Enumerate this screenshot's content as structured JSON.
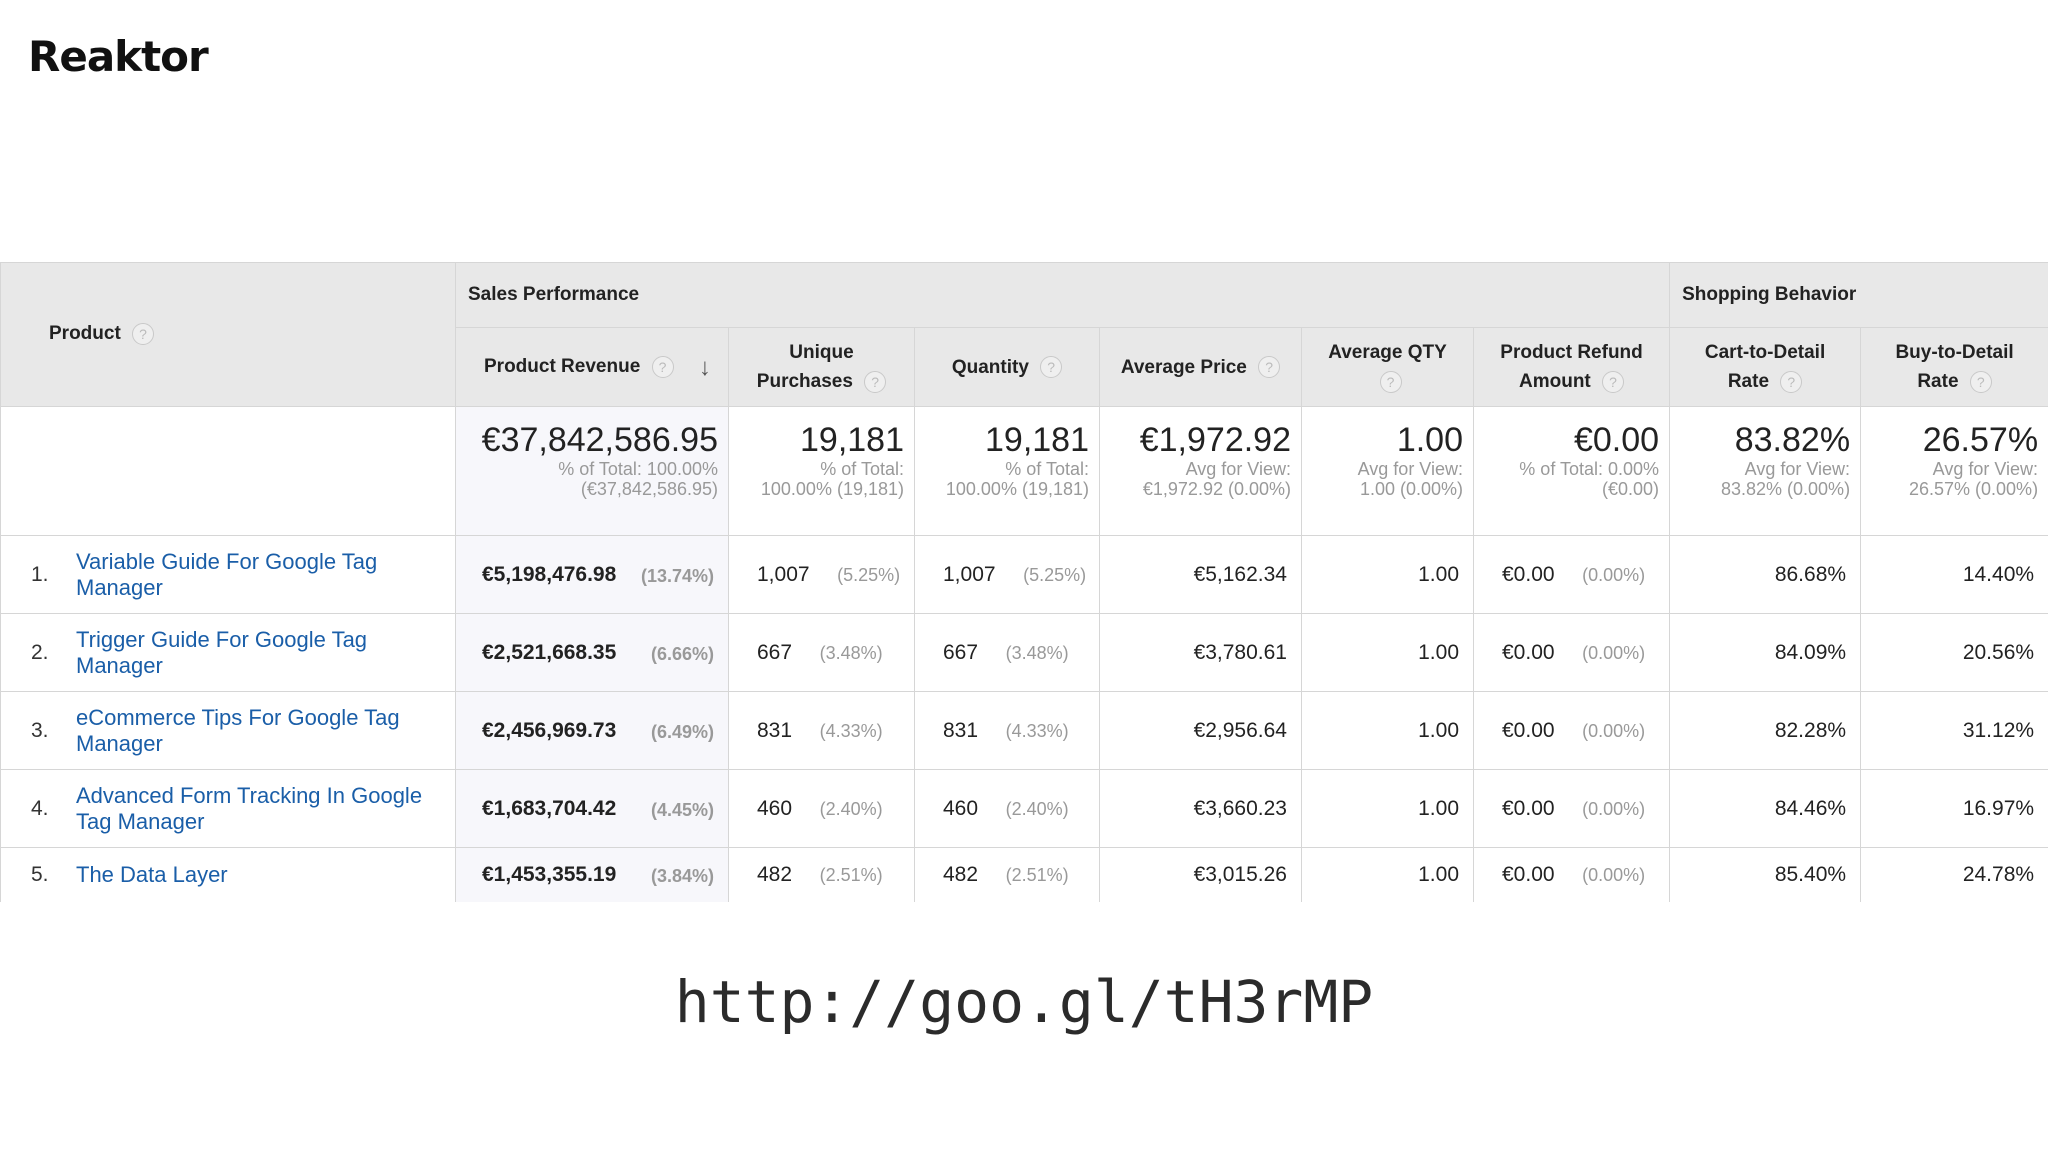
{
  "logo": "Reaktor",
  "groups": {
    "sales": "Sales Performance",
    "shopping": "Shopping Behavior"
  },
  "headers": {
    "product": "Product",
    "revenue": "Product Revenue",
    "unique_l1": "Unique",
    "unique_l2": "Purchases",
    "quantity": "Quantity",
    "avg_price": "Average Price",
    "avg_qty_l1": "Average QTY",
    "refund_l1": "Product Refund",
    "refund_l2": "Amount",
    "c2d_l1": "Cart-to-Detail",
    "c2d_l2": "Rate",
    "b2d_l1": "Buy-to-Detail",
    "b2d_l2": "Rate"
  },
  "totals": {
    "revenue": {
      "value": "€37,842,586.95",
      "s1": "% of Total: 100.00%",
      "s2": "(€37,842,586.95)"
    },
    "unique": {
      "value": "19,181",
      "s1": "% of Total:",
      "s2": "100.00% (19,181)"
    },
    "quantity": {
      "value": "19,181",
      "s1": "% of Total:",
      "s2": "100.00% (19,181)"
    },
    "avg_price": {
      "value": "€1,972.92",
      "s1": "Avg for View:",
      "s2": "€1,972.92 (0.00%)"
    },
    "avg_qty": {
      "value": "1.00",
      "s1": "Avg for View:",
      "s2": "1.00 (0.00%)"
    },
    "refund": {
      "value": "€0.00",
      "s1": "% of Total: 0.00%",
      "s2": "(€0.00)"
    },
    "c2d": {
      "value": "83.82%",
      "s1": "Avg for View:",
      "s2": "83.82% (0.00%)"
    },
    "b2d": {
      "value": "26.57%",
      "s1": "Avg for View:",
      "s2": "26.57% (0.00%)"
    }
  },
  "rows": [
    {
      "rank": "1.",
      "product": "Variable Guide For Google Tag Manager",
      "revenue": "€5,198,476.98",
      "revenue_pct": "(13.74%)",
      "unique": "1,007",
      "unique_pct": "(5.25%)",
      "quantity": "1,007",
      "quantity_pct": "(5.25%)",
      "avg_price": "€5,162.34",
      "avg_qty": "1.00",
      "refund": "€0.00",
      "refund_pct": "(0.00%)",
      "c2d": "86.68%",
      "b2d": "14.40%"
    },
    {
      "rank": "2.",
      "product": "Trigger Guide For Google Tag Manager",
      "revenue": "€2,521,668.35",
      "revenue_pct": "(6.66%)",
      "unique": "667",
      "unique_pct": "(3.48%)",
      "quantity": "667",
      "quantity_pct": "(3.48%)",
      "avg_price": "€3,780.61",
      "avg_qty": "1.00",
      "refund": "€0.00",
      "refund_pct": "(0.00%)",
      "c2d": "84.09%",
      "b2d": "20.56%"
    },
    {
      "rank": "3.",
      "product": "eCommerce Tips For Google Tag Manager",
      "revenue": "€2,456,969.73",
      "revenue_pct": "(6.49%)",
      "unique": "831",
      "unique_pct": "(4.33%)",
      "quantity": "831",
      "quantity_pct": "(4.33%)",
      "avg_price": "€2,956.64",
      "avg_qty": "1.00",
      "refund": "€0.00",
      "refund_pct": "(0.00%)",
      "c2d": "82.28%",
      "b2d": "31.12%"
    },
    {
      "rank": "4.",
      "product": "Advanced Form Tracking In Google Tag Manager",
      "revenue": "€1,683,704.42",
      "revenue_pct": "(4.45%)",
      "unique": "460",
      "unique_pct": "(2.40%)",
      "quantity": "460",
      "quantity_pct": "(2.40%)",
      "avg_price": "€3,660.23",
      "avg_qty": "1.00",
      "refund": "€0.00",
      "refund_pct": "(0.00%)",
      "c2d": "84.46%",
      "b2d": "16.97%"
    },
    {
      "rank": "5.",
      "product": "The Data Layer",
      "revenue": "€1,453,355.19",
      "revenue_pct": "(3.84%)",
      "unique": "482",
      "unique_pct": "(2.51%)",
      "quantity": "482",
      "quantity_pct": "(2.51%)",
      "avg_price": "€3,015.26",
      "avg_qty": "1.00",
      "refund": "€0.00",
      "refund_pct": "(0.00%)",
      "c2d": "85.40%",
      "b2d": "24.78%"
    }
  ],
  "icons": {
    "help": "?",
    "sort": "↓"
  },
  "colors": {
    "link": "#1a5ea8",
    "header_bg": "#e8e8e8",
    "highlight_col": "#f7f7fb"
  },
  "url": "http://goo.gl/tH3rMP"
}
